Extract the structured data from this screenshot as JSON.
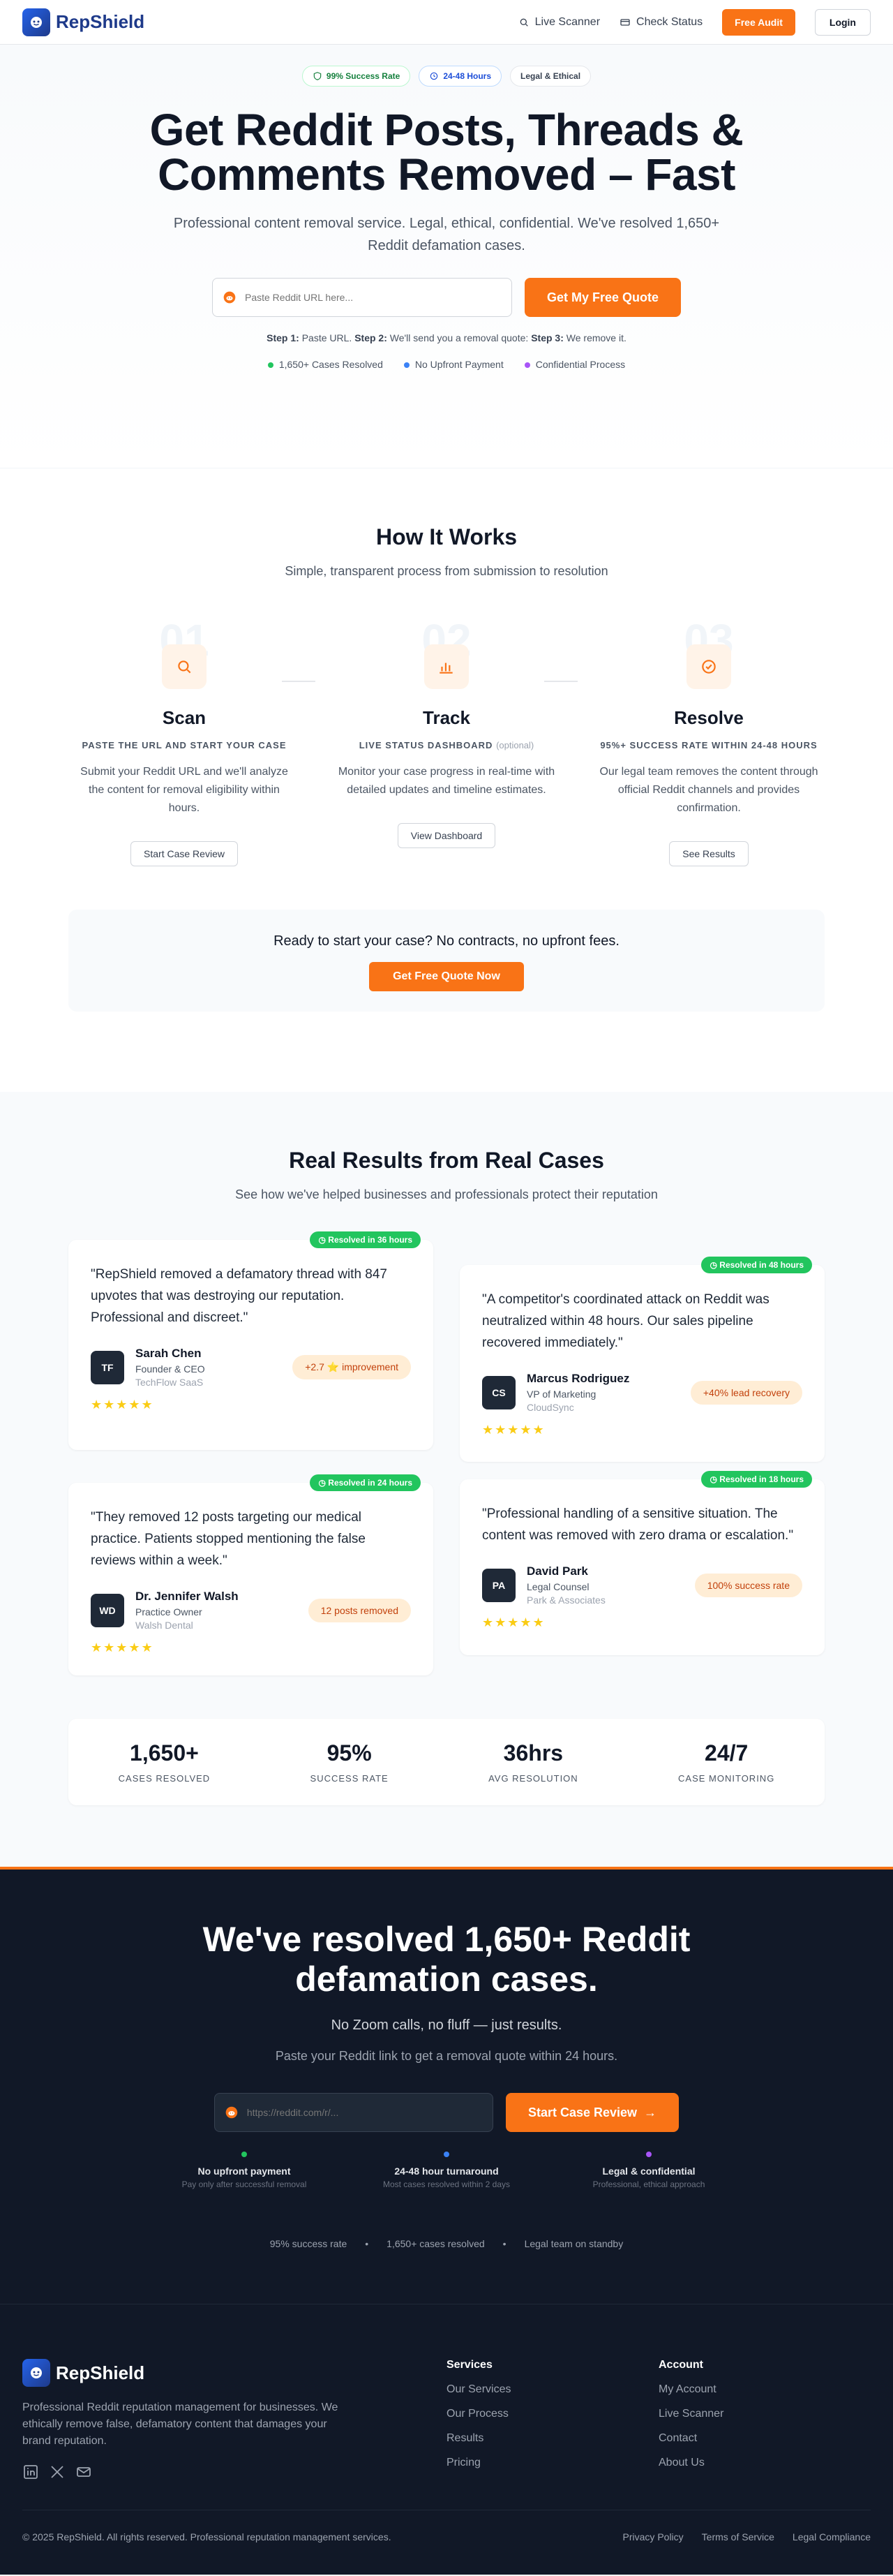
{
  "nav": {
    "brand": "RepShield",
    "live_scanner": "Live Scanner",
    "check_status": "Check Status",
    "free_audit": "Free Audit",
    "login": "Login"
  },
  "hero": {
    "badges": [
      "99% Success Rate",
      "24-48 Hours",
      "Legal & Ethical"
    ],
    "title_line1": "Get Reddit Posts, Threads &",
    "title_line2": "Comments Removed – Fast",
    "subtitle": "Professional content removal service. Legal, ethical, confidential. We've resolved 1,650+ Reddit defamation cases.",
    "input_placeholder": "Paste Reddit URL here...",
    "cta": "Get My Free Quote",
    "step1_label": "Step 1:",
    "step1_text": "Paste URL.",
    "step2_label": "Step 2:",
    "step2_text": "We'll send you a removal quote:",
    "step3_label": "Step 3:",
    "step3_text": "We remove it.",
    "features": [
      "1,650+ Cases Resolved",
      "No Upfront Payment",
      "Confidential Process"
    ],
    "feature_colors": [
      "#22c55e",
      "#3b82f6",
      "#a855f7"
    ]
  },
  "how": {
    "title": "How It Works",
    "subtitle": "Simple, transparent process from submission to resolution",
    "steps": [
      {
        "num": "01",
        "title": "Scan",
        "kicker": "PASTE THE URL AND START YOUR CASE",
        "kicker_extra": "",
        "desc": "Submit your Reddit URL and we'll analyze the content for removal eligibility within hours.",
        "button": "Start Case Review",
        "icon": "search-icon"
      },
      {
        "num": "02",
        "title": "Track",
        "kicker": "LIVE STATUS DASHBOARD",
        "kicker_extra": "(optional)",
        "desc": "Monitor your case progress in real-time with detailed updates and timeline estimates.",
        "button": "View Dashboard",
        "icon": "bar-chart-icon"
      },
      {
        "num": "03",
        "title": "Resolve",
        "kicker": "95%+ SUCCESS RATE WITHIN 24-48 HOURS",
        "kicker_extra": "",
        "desc": "Our legal team removes the content through official Reddit channels and provides confirmation.",
        "button": "See Results",
        "icon": "check-circle-icon"
      }
    ],
    "cta_text": "Ready to start your case? No contracts, no upfront fees.",
    "cta_button": "Get Free Quote Now"
  },
  "results": {
    "title": "Real Results from Real Cases",
    "subtitle": "See how we've helped businesses and professionals protect their reputation",
    "cards": [
      {
        "badge": "Resolved in 36 hours",
        "quote": "\"RepShield removed a defamatory thread with 847 upvotes that was destroying our reputation. Professional and discreet.\"",
        "initials": "TF",
        "name": "Sarah Chen",
        "role": "Founder & CEO",
        "company": "TechFlow SaaS",
        "metric": "+2.7 ⭐ improvement"
      },
      {
        "badge": "Resolved in 48 hours",
        "quote": "\"A competitor's coordinated attack on Reddit was neutralized within 48 hours. Our sales pipeline recovered immediately.\"",
        "initials": "CS",
        "name": "Marcus Rodriguez",
        "role": "VP of Marketing",
        "company": "CloudSync",
        "metric": "+40% lead recovery"
      },
      {
        "badge": "Resolved in 24 hours",
        "quote": "\"They removed 12 posts targeting our medical practice. Patients stopped mentioning the false reviews within a week.\"",
        "initials": "WD",
        "name": "Dr. Jennifer Walsh",
        "role": "Practice Owner",
        "company": "Walsh Dental",
        "metric": "12 posts removed"
      },
      {
        "badge": "Resolved in 18 hours",
        "quote": "\"Professional handling of a sensitive situation. The content was removed with zero drama or escalation.\"",
        "initials": "PA",
        "name": "David Park",
        "role": "Legal Counsel",
        "company": "Park & Associates",
        "metric": "100% success rate"
      }
    ],
    "stars": "★★★★★",
    "stats": [
      {
        "value": "1,650+",
        "label": "CASES RESOLVED"
      },
      {
        "value": "95%",
        "label": "SUCCESS RATE"
      },
      {
        "value": "36hrs",
        "label": "AVG RESOLUTION"
      },
      {
        "value": "24/7",
        "label": "CASE MONITORING"
      }
    ]
  },
  "dark_cta": {
    "title_line1": "We've resolved 1,650+ Reddit",
    "title_line2": "defamation cases.",
    "sub1": "No Zoom calls, no fluff — just results.",
    "sub2": "Paste your Reddit link to get a removal quote within 24 hours.",
    "input_placeholder": "https://reddit.com/r/...",
    "button": "Start Case Review",
    "features": [
      {
        "title": "No upfront payment",
        "desc": "Pay only after successful removal",
        "color": "#22c55e"
      },
      {
        "title": "24-48 hour turnaround",
        "desc": "Most cases resolved within 2 days",
        "color": "#3b82f6"
      },
      {
        "title": "Legal & confidential",
        "desc": "Professional, ethical approach",
        "color": "#a855f7"
      }
    ],
    "trust": [
      "95% success rate",
      "•",
      "1,650+ cases resolved",
      "•",
      "Legal team on standby"
    ]
  },
  "footer": {
    "brand": "RepShield",
    "desc": "Professional Reddit reputation management for businesses. We ethically remove false, defamatory content that damages your brand reputation.",
    "services_title": "Services",
    "services": [
      "Our Services",
      "Our Process",
      "Results",
      "Pricing"
    ],
    "account_title": "Account",
    "account": [
      "My Account",
      "Live Scanner",
      "Contact",
      "About Us"
    ],
    "copyright": "© 2025 RepShield. All rights reserved. Professional reputation management services.",
    "legal_links": [
      "Privacy Policy",
      "Terms of Service",
      "Legal Compliance"
    ]
  },
  "colors": {
    "accent": "#f97316",
    "brand": "#1e3a8a",
    "dark_bg": "#111827",
    "success": "#22c55e"
  }
}
